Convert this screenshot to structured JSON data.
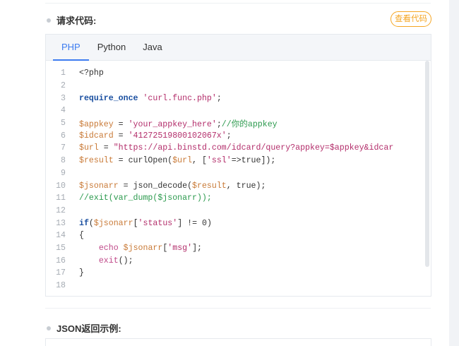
{
  "request_section": {
    "title": "请求代码:"
  },
  "view_code_button": {
    "label": "查看代码"
  },
  "tabs": [
    {
      "label": "PHP",
      "active": true
    },
    {
      "label": "Python",
      "active": false
    },
    {
      "label": "Java",
      "active": false
    }
  ],
  "code_lines": [
    [
      {
        "t": "<?php",
        "c": "plain"
      }
    ],
    [],
    [
      {
        "t": "require_once",
        "c": "kw"
      },
      {
        "t": " ",
        "c": "plain"
      },
      {
        "t": "'curl.func.php'",
        "c": "str"
      },
      {
        "t": ";",
        "c": "plain"
      }
    ],
    [],
    [
      {
        "t": "$appkey",
        "c": "var"
      },
      {
        "t": " = ",
        "c": "plain"
      },
      {
        "t": "'your_appkey_here'",
        "c": "str"
      },
      {
        "t": ";",
        "c": "plain"
      },
      {
        "t": "//你的appkey",
        "c": "cmt"
      }
    ],
    [
      {
        "t": "$idcard",
        "c": "var"
      },
      {
        "t": " = ",
        "c": "plain"
      },
      {
        "t": "'41272519800102067x'",
        "c": "str"
      },
      {
        "t": ";",
        "c": "plain"
      }
    ],
    [
      {
        "t": "$url",
        "c": "var"
      },
      {
        "t": " = ",
        "c": "plain"
      },
      {
        "t": "\"https://api.binstd.com/idcard/query?appkey=$appkey&idcar",
        "c": "str"
      }
    ],
    [
      {
        "t": "$result",
        "c": "var"
      },
      {
        "t": " = curlOpen(",
        "c": "plain"
      },
      {
        "t": "$url",
        "c": "var"
      },
      {
        "t": ", [",
        "c": "plain"
      },
      {
        "t": "'ssl'",
        "c": "str"
      },
      {
        "t": "=>true]);",
        "c": "plain"
      }
    ],
    [],
    [
      {
        "t": "$jsonarr",
        "c": "var"
      },
      {
        "t": " = json_decode(",
        "c": "plain"
      },
      {
        "t": "$result",
        "c": "var"
      },
      {
        "t": ", true);",
        "c": "plain"
      }
    ],
    [
      {
        "t": "//exit(var_dump($jsonarr));",
        "c": "cmt"
      }
    ],
    [],
    [
      {
        "t": "if",
        "c": "kw"
      },
      {
        "t": "(",
        "c": "plain"
      },
      {
        "t": "$jsonarr",
        "c": "var"
      },
      {
        "t": "[",
        "c": "plain"
      },
      {
        "t": "'status'",
        "c": "str"
      },
      {
        "t": "] != 0)",
        "c": "plain"
      }
    ],
    [
      {
        "t": "{",
        "c": "plain"
      }
    ],
    [
      {
        "t": "    ",
        "c": "plain"
      },
      {
        "t": "echo",
        "c": "fn"
      },
      {
        "t": " ",
        "c": "plain"
      },
      {
        "t": "$jsonarr",
        "c": "var"
      },
      {
        "t": "[",
        "c": "plain"
      },
      {
        "t": "'msg'",
        "c": "str"
      },
      {
        "t": "];",
        "c": "plain"
      }
    ],
    [
      {
        "t": "    ",
        "c": "plain"
      },
      {
        "t": "exit",
        "c": "fn"
      },
      {
        "t": "();",
        "c": "plain"
      }
    ],
    [
      {
        "t": "}",
        "c": "plain"
      }
    ],
    []
  ],
  "json_section": {
    "title": "JSON返回示例:"
  },
  "colors": {
    "accent_blue": "#3d7cf0",
    "button_orange": "#f5a623",
    "keyword": "#1a4fa0",
    "string": "#b32e6b",
    "variable": "#c97a37",
    "comment": "#2c9a4e"
  }
}
